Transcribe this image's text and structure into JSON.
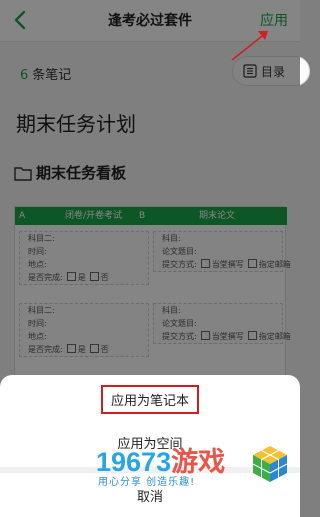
{
  "header": {
    "title": "逢考必过套件",
    "apply_label": "应用"
  },
  "notes": {
    "count": "6",
    "count_suffix": "条笔记",
    "toc_label": "目录"
  },
  "document": {
    "title": "期末任务计划",
    "board_title": "期末任务看板"
  },
  "board": {
    "col_a_letter": "A",
    "col_a_title": "闭卷/开卷考试",
    "col_b_letter": "B",
    "col_b_title": "期末论文",
    "a_lines": [
      "科目二:",
      "时间:",
      "地点:",
      "是否完成:"
    ],
    "a_yes": "是",
    "a_no": "否",
    "b_lines": [
      "科目:",
      "论文题目:",
      "提交方式:"
    ],
    "b_opt1": "当堂撰写",
    "b_opt2": "指定邮箱"
  },
  "sheet": {
    "option_notebook": "应用为笔记本",
    "option_space": "应用为空间",
    "cancel": "取消"
  },
  "watermark": {
    "number": "19673",
    "name": "游戏",
    "slogan": "用心分享 创造乐趣!"
  },
  "colors": {
    "accent": "#1aa64a",
    "annotation": "#d11f1f"
  }
}
